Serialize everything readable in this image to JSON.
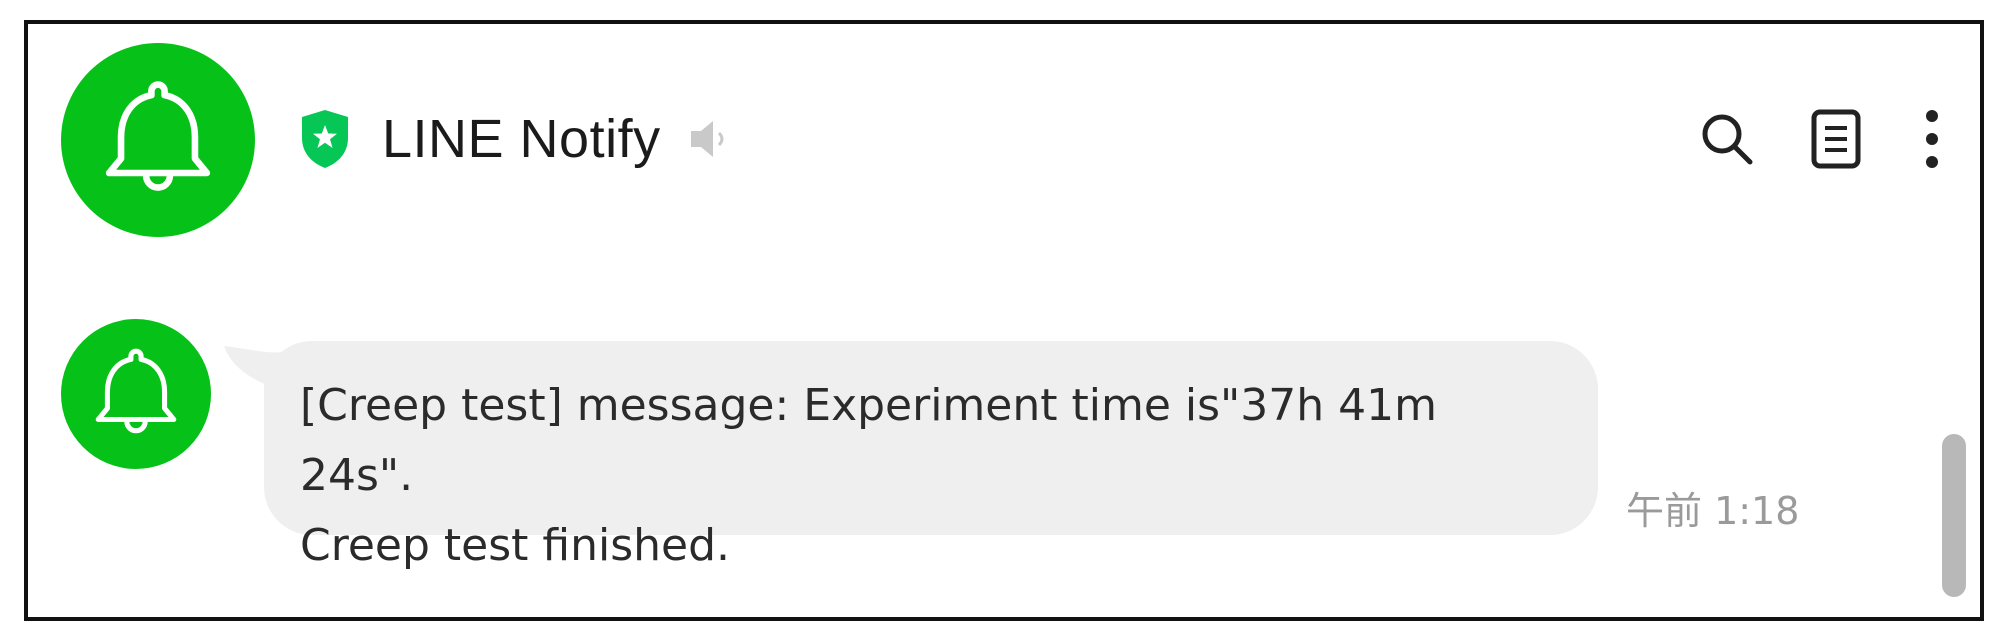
{
  "header": {
    "title": "LINE Notify",
    "avatar_icon": "bell-icon",
    "badge_icon": "verified-shield-star-icon",
    "mute_icon": "speaker-muted-icon",
    "actions": {
      "search_icon": "search-icon",
      "notes_icon": "notes-icon",
      "more_icon": "more-vertical-icon"
    }
  },
  "messages": [
    {
      "sender_avatar_icon": "bell-icon",
      "text": "[Creep test] message: Experiment time is\"37h 41m 24s\".\nCreep test finished.",
      "time": "午前 1:18"
    }
  ],
  "colors": {
    "brand_green": "#06c218",
    "badge_green": "#06c755",
    "bubble_bg": "#efefef",
    "timestamp": "#9a9a9a",
    "scrollbar": "#b8b8b8"
  }
}
